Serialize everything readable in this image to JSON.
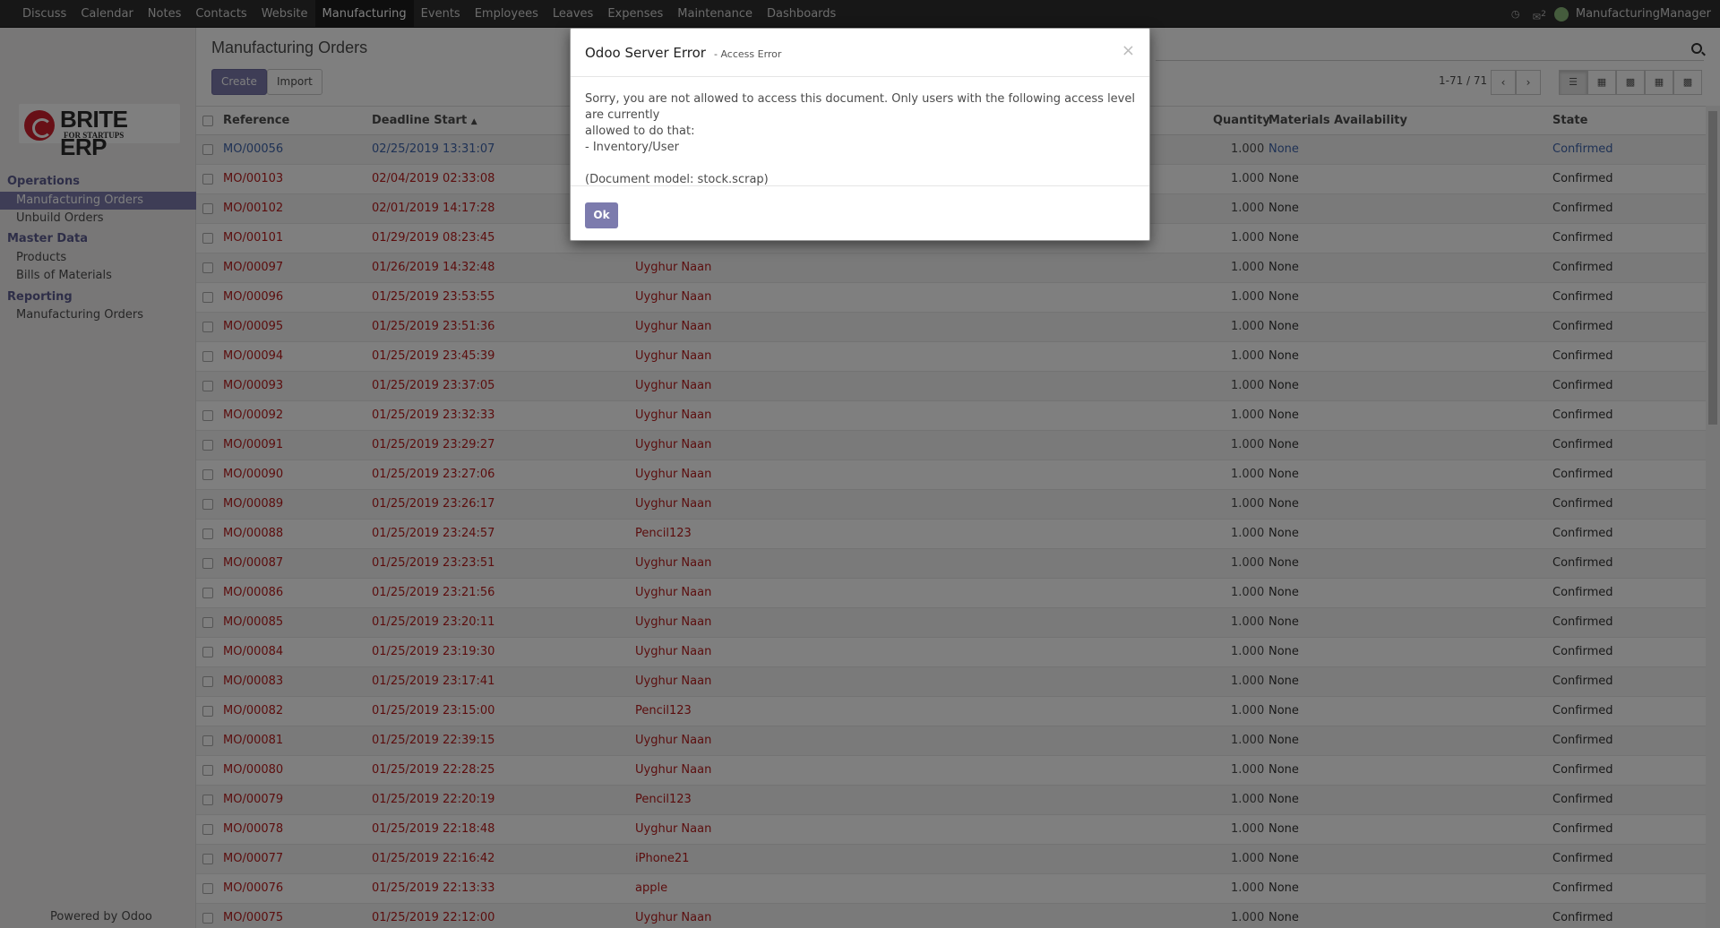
{
  "topbar": {
    "menu": [
      "Discuss",
      "Calendar",
      "Notes",
      "Contacts",
      "Website",
      "Manufacturing",
      "Events",
      "Employees",
      "Leaves",
      "Expenses",
      "Maintenance",
      "Dashboards"
    ],
    "active_index": 5,
    "chat_count": "2",
    "user": "ManufacturingManager"
  },
  "sidebar": {
    "brand": "BRITE ERP",
    "tagline": "FOR STARTUPS",
    "sections": [
      {
        "title": "Operations",
        "items": [
          "Manufacturing Orders",
          "Unbuild Orders"
        ]
      },
      {
        "title": "Master Data",
        "items": [
          "Products",
          "Bills of Materials"
        ]
      },
      {
        "title": "Reporting",
        "items": [
          "Manufacturing Orders"
        ]
      }
    ],
    "powered": "Powered by Odoo"
  },
  "main": {
    "title": "Manufacturing Orders",
    "create_label": "Create",
    "import_label": "Import",
    "pager": "1-71 / 71"
  },
  "table": {
    "headers": {
      "reference": "Reference",
      "deadline": "Deadline Start",
      "quantity": "Quantity",
      "materials": "Materials Availability",
      "state": "State"
    },
    "rows": [
      [
        "MO/00056",
        "02/25/2019 13:31:07",
        "",
        "1.000",
        "None",
        "Confirmed"
      ],
      [
        "MO/00103",
        "02/04/2019 02:33:08",
        "",
        "1.000",
        "None",
        "Confirmed"
      ],
      [
        "MO/00102",
        "02/01/2019 14:17:28",
        "",
        "1.000",
        "None",
        "Confirmed"
      ],
      [
        "MO/00101",
        "01/29/2019 08:23:45",
        "",
        "1.000",
        "None",
        "Confirmed"
      ],
      [
        "MO/00097",
        "01/26/2019 14:32:48",
        "Uyghur Naan",
        "1.000",
        "None",
        "Confirmed"
      ],
      [
        "MO/00096",
        "01/25/2019 23:53:55",
        "Uyghur Naan",
        "1.000",
        "None",
        "Confirmed"
      ],
      [
        "MO/00095",
        "01/25/2019 23:51:36",
        "Uyghur Naan",
        "1.000",
        "None",
        "Confirmed"
      ],
      [
        "MO/00094",
        "01/25/2019 23:45:39",
        "Uyghur Naan",
        "1.000",
        "None",
        "Confirmed"
      ],
      [
        "MO/00093",
        "01/25/2019 23:37:05",
        "Uyghur Naan",
        "1.000",
        "None",
        "Confirmed"
      ],
      [
        "MO/00092",
        "01/25/2019 23:32:33",
        "Uyghur Naan",
        "1.000",
        "None",
        "Confirmed"
      ],
      [
        "MO/00091",
        "01/25/2019 23:29:27",
        "Uyghur Naan",
        "1.000",
        "None",
        "Confirmed"
      ],
      [
        "MO/00090",
        "01/25/2019 23:27:06",
        "Uyghur Naan",
        "1.000",
        "None",
        "Confirmed"
      ],
      [
        "MO/00089",
        "01/25/2019 23:26:17",
        "Uyghur Naan",
        "1.000",
        "None",
        "Confirmed"
      ],
      [
        "MO/00088",
        "01/25/2019 23:24:57",
        "Pencil123",
        "1.000",
        "None",
        "Confirmed"
      ],
      [
        "MO/00087",
        "01/25/2019 23:23:51",
        "Uyghur Naan",
        "1.000",
        "None",
        "Confirmed"
      ],
      [
        "MO/00086",
        "01/25/2019 23:21:56",
        "Uyghur Naan",
        "1.000",
        "None",
        "Confirmed"
      ],
      [
        "MO/00085",
        "01/25/2019 23:20:11",
        "Uyghur Naan",
        "1.000",
        "None",
        "Confirmed"
      ],
      [
        "MO/00084",
        "01/25/2019 23:19:30",
        "Uyghur Naan",
        "1.000",
        "None",
        "Confirmed"
      ],
      [
        "MO/00083",
        "01/25/2019 23:17:41",
        "Uyghur Naan",
        "1.000",
        "None",
        "Confirmed"
      ],
      [
        "MO/00082",
        "01/25/2019 23:15:00",
        "Pencil123",
        "1.000",
        "None",
        "Confirmed"
      ],
      [
        "MO/00081",
        "01/25/2019 22:39:15",
        "Uyghur Naan",
        "1.000",
        "None",
        "Confirmed"
      ],
      [
        "MO/00080",
        "01/25/2019 22:28:25",
        "Uyghur Naan",
        "1.000",
        "None",
        "Confirmed"
      ],
      [
        "MO/00079",
        "01/25/2019 22:20:19",
        "Pencil123",
        "1.000",
        "None",
        "Confirmed"
      ],
      [
        "MO/00078",
        "01/25/2019 22:18:48",
        "Uyghur Naan",
        "1.000",
        "None",
        "Confirmed"
      ],
      [
        "MO/00077",
        "01/25/2019 22:16:42",
        "iPhone21",
        "1.000",
        "None",
        "Confirmed"
      ],
      [
        "MO/00076",
        "01/25/2019 22:13:33",
        "apple",
        "1.000",
        "None",
        "Confirmed"
      ],
      [
        "MO/00075",
        "01/25/2019 22:12:00",
        "Uyghur Naan",
        "1.000",
        "None",
        "Confirmed"
      ]
    ]
  },
  "modal": {
    "title": "Odoo Server Error",
    "subtitle": "- Access Error",
    "close": "×",
    "line1": "Sorry, you are not allowed to access this document. Only users with the following access level are currently",
    "line2": "allowed to do that:",
    "line3": "- Inventory/User",
    "line4": "(Document model: stock.scrap)",
    "ok_label": "Ok"
  },
  "colors": {
    "brand_purple": "#7c7bad",
    "link_red": "#b71c1c",
    "link_blue": "#3f64ab",
    "topbar": "#2f2f2f"
  }
}
